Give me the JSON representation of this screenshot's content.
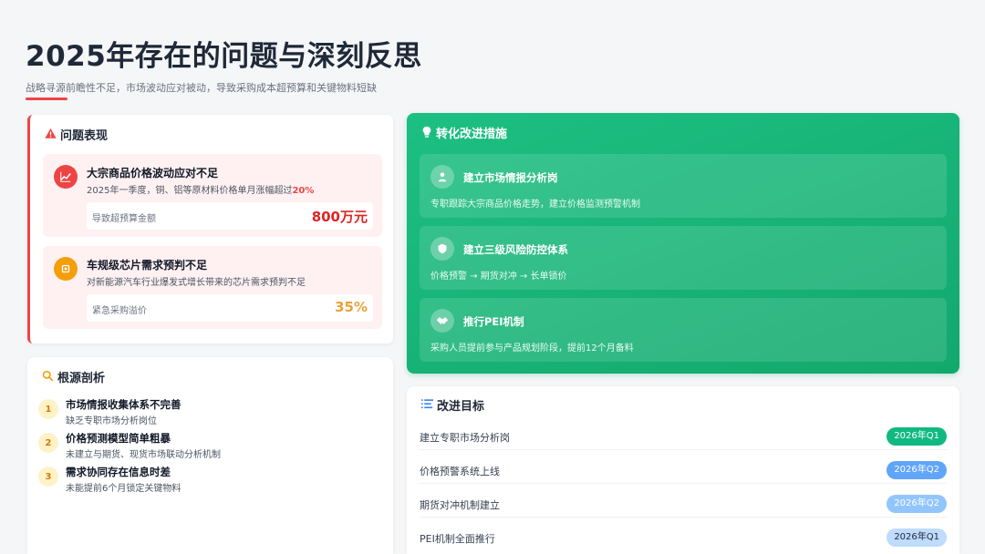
{
  "header": {
    "title": "2025年存在的问题与深刻反思",
    "subtitle": "战略寻源前瞻性不足，市场波动应对被动，导致采购成本超预算和关键物料短缺"
  },
  "problems": {
    "title": "问题表现",
    "items": [
      {
        "icon": "trend-chart-icon",
        "title": "大宗商品价格波动应对不足",
        "desc": "2025年一季度，铜、铝等原材料价格单月涨幅超过",
        "desc_highlight": "20%",
        "metric_label": "导致超预算金额",
        "metric_value": "800万元",
        "color": "#ef4444"
      },
      {
        "icon": "chip-icon",
        "title": "车规级芯片需求预判不足",
        "desc": "对新能源汽车行业爆发式增长带来的芯片需求预判不足",
        "desc_highlight": "",
        "metric_label": "紧急采购溢价",
        "metric_value": "35%",
        "color": "#f59e0b"
      }
    ]
  },
  "rootcause": {
    "title": "根源剖析",
    "items": [
      {
        "num": "1",
        "title": "市场情报收集体系不完善",
        "desc": "缺乏专职市场分析岗位"
      },
      {
        "num": "2",
        "title": "价格预测模型简单粗暴",
        "desc": "未建立与期货、现货市场联动分析机制"
      },
      {
        "num": "3",
        "title": "需求协同存在信息时差",
        "desc": "未能提前6个月锁定关键物料"
      }
    ]
  },
  "measures": {
    "title": "转化改进措施",
    "items": [
      {
        "icon": "person-icon",
        "title": "建立市场情报分析岗",
        "desc": "专职跟踪大宗商品价格走势，建立价格监测预警机制"
      },
      {
        "icon": "shield-icon",
        "title": "建立三级风险防控体系",
        "desc": "价格预警 → 期货对冲 → 长单锁价"
      },
      {
        "icon": "handshake-icon",
        "title": "推行PEI机制",
        "desc": "采购人员提前参与产品规划阶段，提前12个月备料"
      }
    ]
  },
  "goals": {
    "title": "改进目标",
    "items": [
      {
        "label": "建立专职市场分析岗",
        "badge": "2026年Q1",
        "color": "#10b981"
      },
      {
        "label": "价格预警系统上线",
        "badge": "2026年Q2",
        "color": "#60a5fa"
      },
      {
        "label": "期货对冲机制建立",
        "badge": "2026年Q2",
        "color": "#93c5fd"
      },
      {
        "label": "PEI机制全面推行",
        "badge": "2026年Q1",
        "color": "#bfdbfe"
      }
    ]
  },
  "colors": {
    "accent_red": "#ef4444",
    "accent_green": "#12a96c",
    "accent_amber": "#f59e0b"
  }
}
